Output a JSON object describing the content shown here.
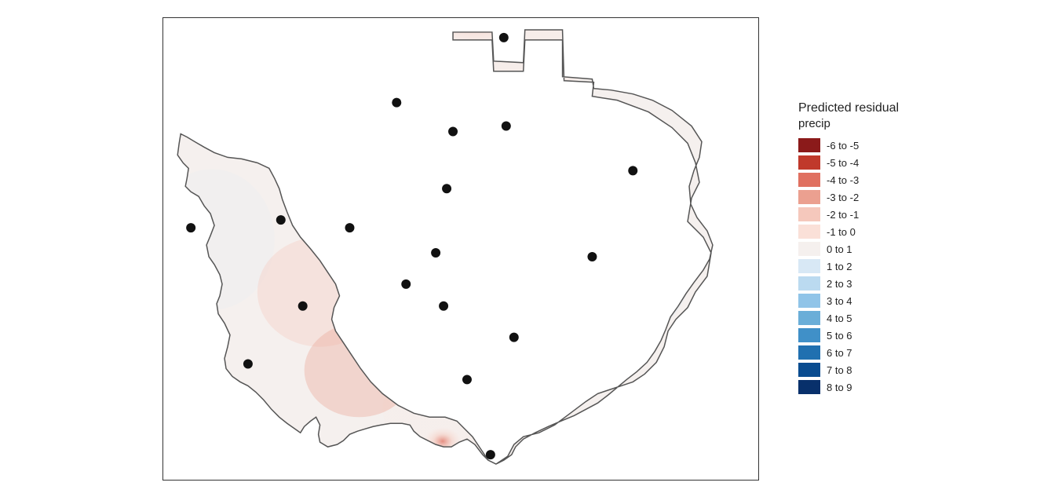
{
  "title": "Predicted residual precip",
  "legend": {
    "title_line1": "Predicted residual",
    "title_line2": "precip",
    "items": [
      {
        "label": "-6 to -5",
        "color": "#8B1A1A"
      },
      {
        "label": "-5 to -4",
        "color": "#C0392B"
      },
      {
        "label": "-4 to -3",
        "color": "#E07060"
      },
      {
        "label": "-3 to -2",
        "color": "#EBA090"
      },
      {
        "label": "-2 to -1",
        "color": "#F5C8BC"
      },
      {
        "label": "-1 to 0",
        "color": "#FAE0D8"
      },
      {
        "label": "0 to 1",
        "color": "#F5F0EE"
      },
      {
        "label": "1 to 2",
        "color": "#D8E8F5"
      },
      {
        "label": "2 to 3",
        "color": "#BBDAF0"
      },
      {
        "label": "3 to 4",
        "color": "#90C4E8"
      },
      {
        "label": "4 to 5",
        "color": "#6AAED8"
      },
      {
        "label": "5 to 6",
        "color": "#4090C8"
      },
      {
        "label": "6 to 7",
        "color": "#2070B0"
      },
      {
        "label": "7 to 8",
        "color": "#0A4C90"
      },
      {
        "label": "8 to 9",
        "color": "#08306B"
      }
    ]
  }
}
